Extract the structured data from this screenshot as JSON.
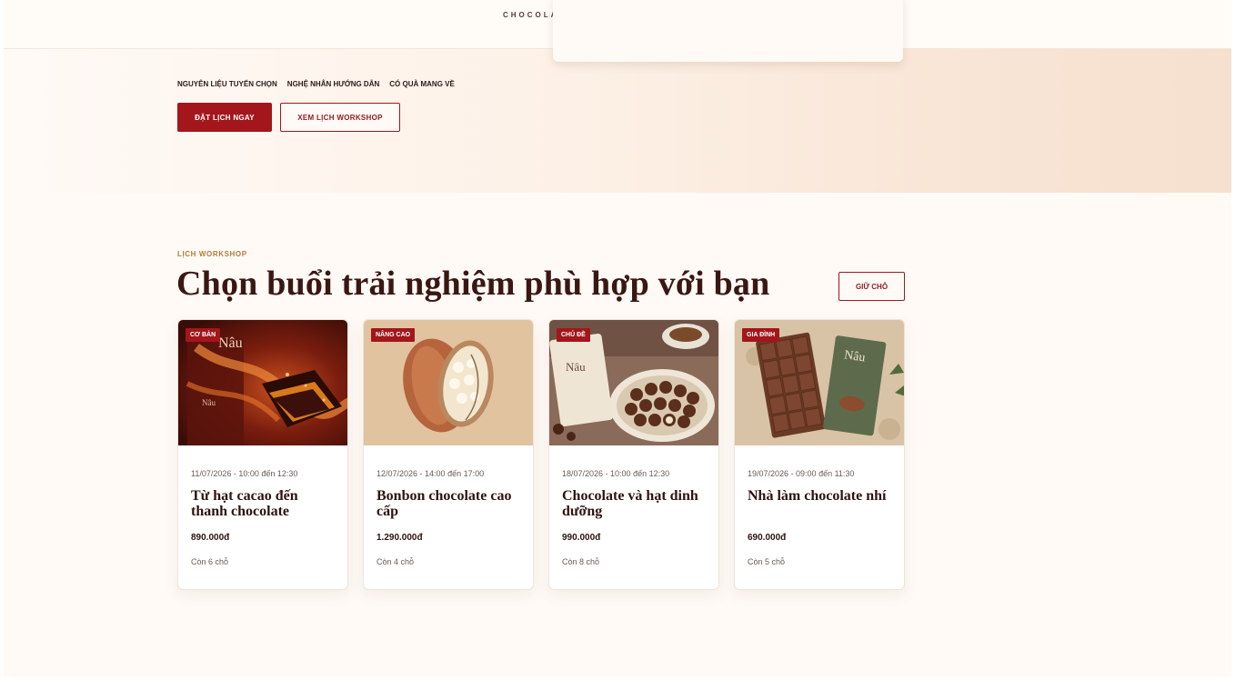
{
  "header": {
    "brand": "CHOCOLATE"
  },
  "hero": {
    "features": [
      "NGUYÊN LIỆU TUYỂN CHỌN",
      "NGHỆ NHÂN HƯỚNG DẪN",
      "CÓ QUÀ MANG VỀ"
    ],
    "primary_button": "ĐẶT LỊCH NGAY",
    "secondary_button": "XEM LỊCH WORKSHOP"
  },
  "section": {
    "eyebrow": "LỊCH WORKSHOP",
    "title": "Chọn buổi trải nghiệm phù hợp với bạn",
    "reserve_button": "GIỮ CHỖ"
  },
  "cards": [
    {
      "badge": "CƠ BẢN",
      "date": "11/07/2026 - 10:00 đến 12:30",
      "title": "Từ hạt cacao đến thanh chocolate",
      "price": "890.000đ",
      "seats": "Còn 6 chỗ",
      "image": "caramel-chocolate-photo",
      "image_text": "Nâu"
    },
    {
      "badge": "NÂNG CAO",
      "date": "12/07/2026 - 14:00 đến 17:00",
      "title": "Bonbon chocolate cao cấp",
      "price": "1.290.000đ",
      "seats": "Còn 4 chỗ",
      "image": "cacao-pod-illustration"
    },
    {
      "badge": "CHỦ ĐỀ",
      "date": "18/07/2026 - 10:00 đến 12:30",
      "title": "Chocolate và hạt dinh dưỡng",
      "price": "990.000đ",
      "seats": "Còn 8 chỗ",
      "image": "truffle-box-photo",
      "image_text": "Nâu"
    },
    {
      "badge": "GIA ĐÌNH",
      "date": "19/07/2026 - 09:00 đến 11:30",
      "title": "Nhà làm chocolate nhí",
      "price": "690.000đ",
      "seats": "Còn 5 chỗ",
      "image": "chocolate-bar-photo",
      "image_text": "Nâu"
    }
  ],
  "colors": {
    "accent": "#a3161b",
    "title": "#3a1713",
    "eyebrow": "#b07c3e",
    "background": "#fffaf6"
  }
}
